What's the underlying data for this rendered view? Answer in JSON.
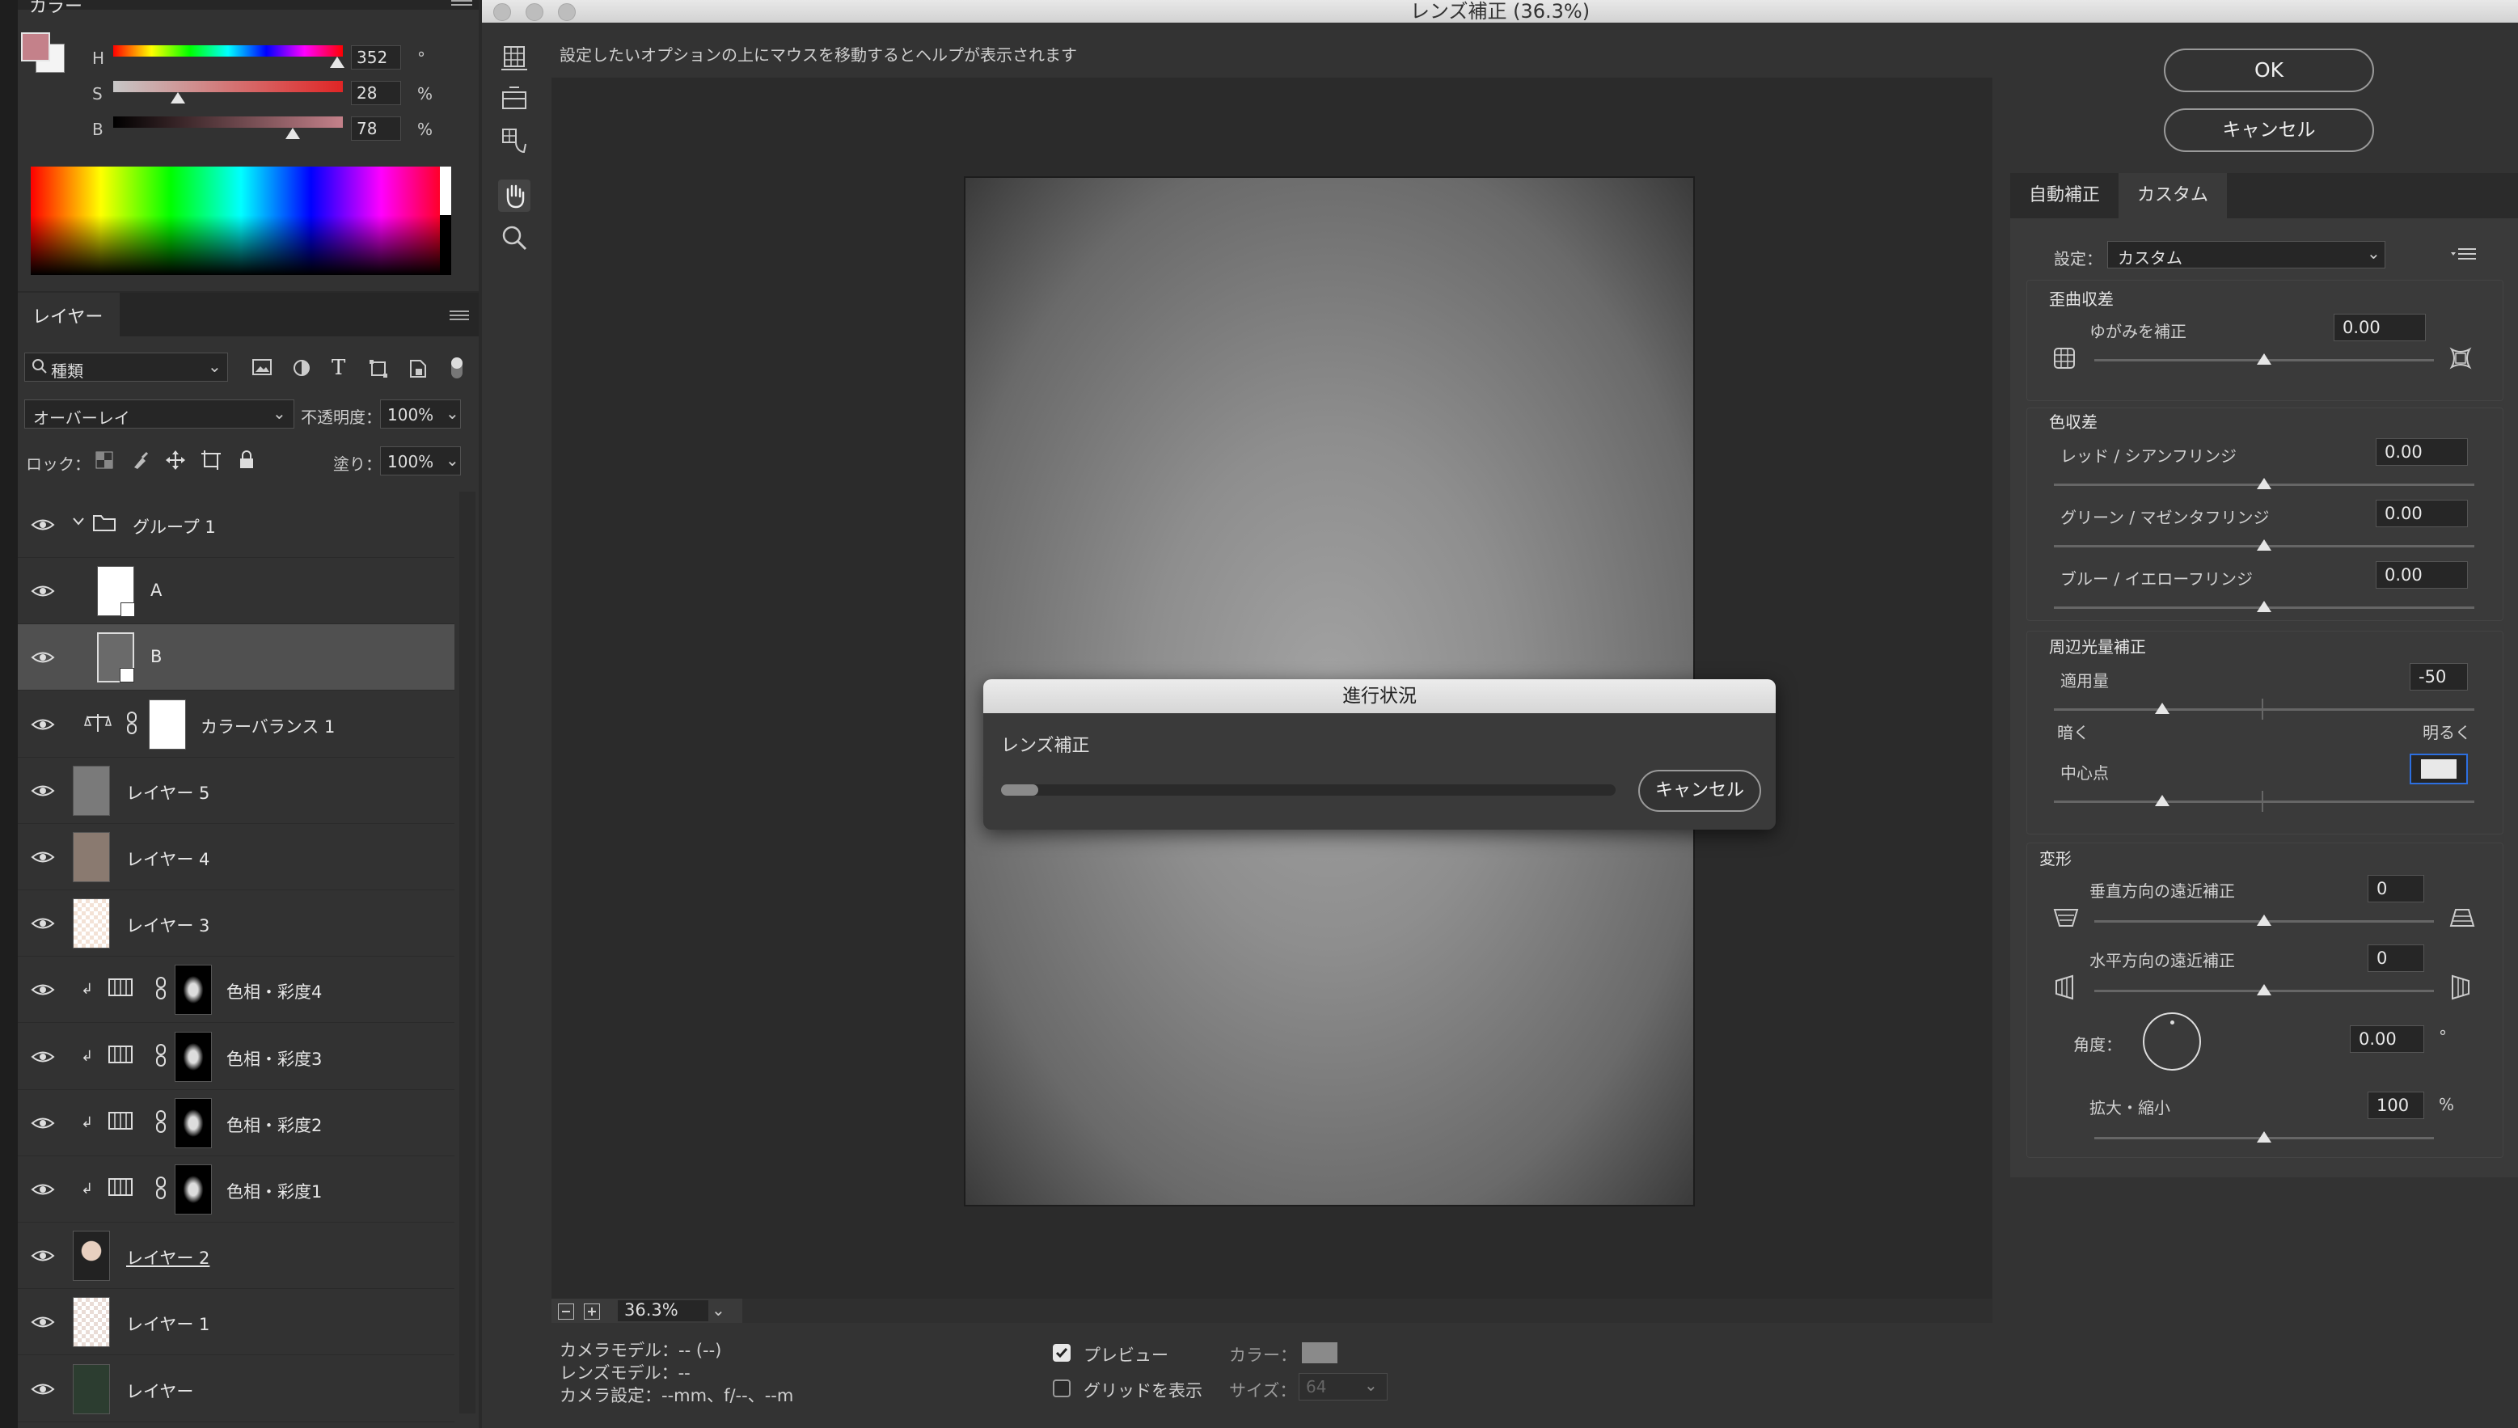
{
  "color_panel": {
    "tab_title": "カラー",
    "labels": {
      "h": "H",
      "s": "S",
      "b": "B"
    },
    "values": {
      "h": "352",
      "s": "28",
      "b": "78"
    },
    "units": {
      "h": "°",
      "s": "%",
      "b": "%"
    },
    "slider_levels": {
      "h": 0.977,
      "s": 0.28,
      "b": 0.78
    },
    "foreground_color": "#c4818a"
  },
  "layers_panel": {
    "tab_title": "レイヤー",
    "filter_kind": "種類",
    "blend_mode": "オーバーレイ",
    "opacity_label": "不透明度：",
    "opacity_value": "100%",
    "lock_label": "ロック：",
    "fill_label": "塗り：",
    "fill_value": "100%",
    "layers": [
      {
        "name": "グループ 1",
        "kind": "group"
      },
      {
        "name": "A",
        "kind": "smart"
      },
      {
        "name": "B",
        "kind": "smart",
        "selected": true
      },
      {
        "name": "カラーバランス 1",
        "kind": "adjust-balance"
      },
      {
        "name": "レイヤー 5",
        "kind": "gray"
      },
      {
        "name": "レイヤー 4",
        "kind": "taupe"
      },
      {
        "name": "レイヤー 3",
        "kind": "transparent-peach"
      },
      {
        "name": "色相・彩度4",
        "kind": "hue"
      },
      {
        "name": "色相・彩度3",
        "kind": "hue"
      },
      {
        "name": "色相・彩度2",
        "kind": "hue"
      },
      {
        "name": "色相・彩度1",
        "kind": "hue"
      },
      {
        "name": "レイヤー 2",
        "kind": "photo"
      },
      {
        "name": "レイヤー 1",
        "kind": "transparent"
      },
      {
        "name": "レイヤー",
        "kind": "dark-green"
      }
    ]
  },
  "dialog": {
    "title": "レンズ補正 (36.3%)",
    "help_text": "設定したいオプションの上にマウスを移動するとヘルプが表示されます",
    "ok_label": "OK",
    "cancel_label": "キャンセル",
    "zoom_value": "36.3%",
    "camera_model": "カメラモデル：-- (--)",
    "lens_model": "レンズモデル：--",
    "camera_settings": "カメラ設定：--mm、f/--、--m",
    "preview_label": "プレビュー",
    "grid_label": "グリッドを表示",
    "color_label": "カラー：",
    "size_label": "サイズ：",
    "size_value": "64"
  },
  "progress": {
    "title": "進行状況",
    "task": "レンズ補正",
    "cancel_label": "キャンセル",
    "fraction": 0.06
  },
  "custom_panel": {
    "tabs": [
      "自動補正",
      "カスタム"
    ],
    "settings_label": "設定：",
    "settings_value": "カスタム",
    "distortion": {
      "title": "歪曲収差",
      "label": "ゆがみを補正",
      "value": "0.00"
    },
    "chromatic": {
      "title": "色収差",
      "rows": [
        {
          "label": "レッド / シアンフリンジ",
          "value": "0.00"
        },
        {
          "label": "グリーン / マゼンタフリンジ",
          "value": "0.00"
        },
        {
          "label": "ブルー / イエローフリンジ",
          "value": "0.00"
        }
      ]
    },
    "vignette": {
      "title": "周辺光量補正",
      "amount_label": "適用量",
      "amount_value": "-50",
      "dark_label": "暗く",
      "bright_label": "明るく",
      "midpoint_label": "中心点"
    },
    "transform": {
      "title": "変形",
      "vertical_label": "垂直方向の遠近補正",
      "vertical_value": "0",
      "horizontal_label": "水平方向の遠近補正",
      "horizontal_value": "0",
      "angle_label": "角度：",
      "angle_value": "0.00",
      "angle_unit": "°",
      "scale_label": "拡大・縮小",
      "scale_value": "100",
      "scale_unit": "%"
    }
  }
}
